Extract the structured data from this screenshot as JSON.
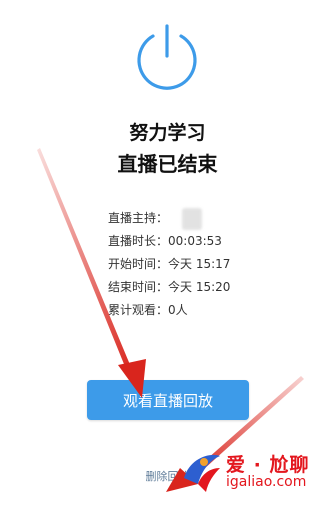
{
  "screen": {
    "title_line1": "努力学习",
    "title_line2": "直播已结束"
  },
  "info": {
    "host_label": "直播主持：",
    "duration_label": "直播时长：",
    "duration_value": "00:03:53",
    "start_label": "开始时间：",
    "start_value": "今天 15:17",
    "end_label": "结束时间：",
    "end_value": "今天 15:20",
    "viewers_label": "累计观看：",
    "viewers_value": "0人"
  },
  "actions": {
    "watch_replay": "观看直播回放",
    "delete_replay": "删除回放"
  },
  "watermark": {
    "brand": "爱 · 尬聊",
    "url": "igaliao.com"
  },
  "colors": {
    "accent": "#3d9be9",
    "arrow": "#d9251d",
    "watermark": "#e3171e"
  },
  "icons": {
    "power": "power-icon"
  }
}
